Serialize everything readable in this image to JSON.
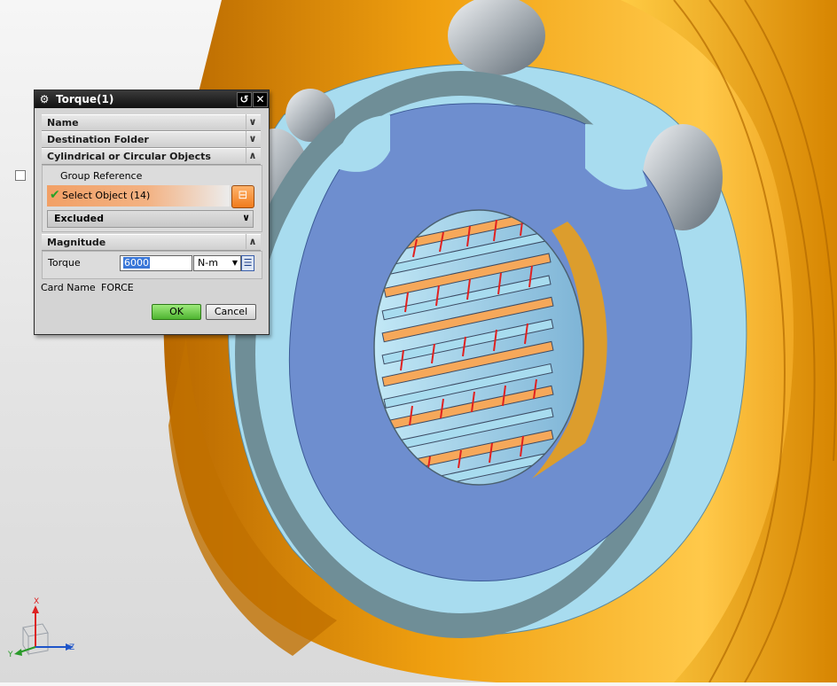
{
  "dialog": {
    "title": "Torque(1)",
    "sections": {
      "name": "Name",
      "destination_folder": "Destination Folder",
      "cylindrical_objects": "Cylindrical or Circular Objects",
      "magnitude": "Magnitude"
    },
    "group_reference_label": "Group Reference",
    "select_object_label": "Select Object (14)",
    "excluded_label": "Excluded",
    "torque_label": "Torque",
    "torque_value": "6000",
    "torque_unit": "N-m",
    "card_name_label": "Card Name",
    "card_name_value": "FORCE",
    "ok_label": "OK",
    "cancel_label": "Cancel"
  },
  "triad": {
    "x_label": "X",
    "y_label": "Y",
    "z_label": "Z"
  },
  "colors": {
    "housing_orange": "#f0a010",
    "ring_cyan": "#a8dcef",
    "disk_blue": "#6e8ecf",
    "spline_red": "#e02020",
    "ok_green": "#4fb431",
    "select_orange": "#f07b1c"
  }
}
